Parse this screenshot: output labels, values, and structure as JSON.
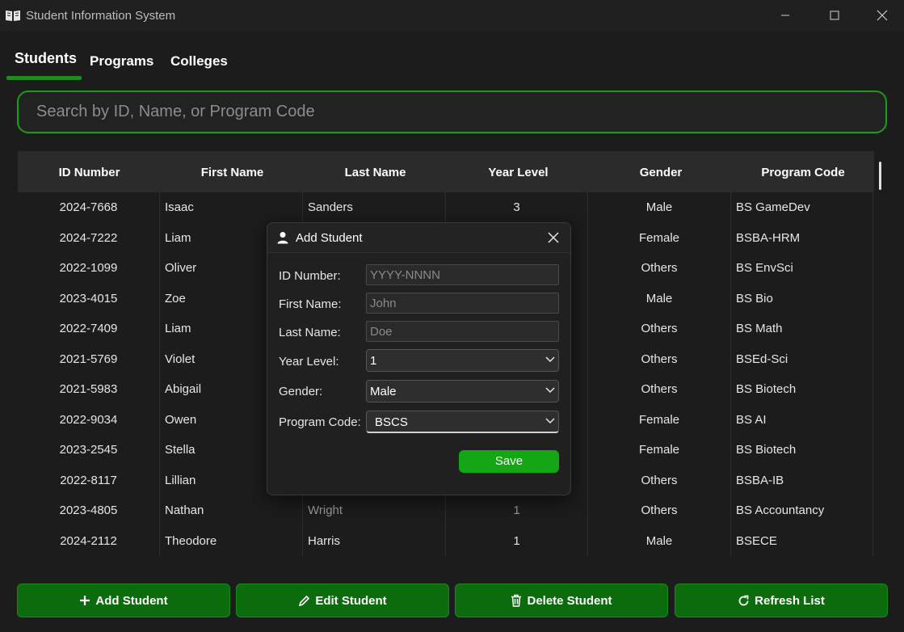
{
  "window": {
    "title": "Student Information System"
  },
  "tabs": [
    "Students",
    "Programs",
    "Colleges"
  ],
  "search": {
    "placeholder": "Search by ID, Name, or Program Code",
    "value": ""
  },
  "table": {
    "columns": [
      "ID Number",
      "First Name",
      "Last Name",
      "Year Level",
      "Gender",
      "Program Code"
    ],
    "rows": [
      [
        "2024-7668",
        "Isaac",
        "Sanders",
        "3",
        "Male",
        "BS GameDev"
      ],
      [
        "2024-7222",
        "Liam",
        "",
        "",
        "Female",
        "BSBA-HRM"
      ],
      [
        "2022-1099",
        "Oliver",
        "",
        "",
        "Others",
        "BS EnvSci"
      ],
      [
        "2023-4015",
        "Zoe",
        "",
        "",
        "Male",
        "BS Bio"
      ],
      [
        "2022-7409",
        "Liam",
        "",
        "",
        "Others",
        "BS Math"
      ],
      [
        "2021-5769",
        "Violet",
        "",
        "",
        "Others",
        "BSEd-Sci"
      ],
      [
        "2021-5983",
        "Abigail",
        "",
        "",
        "Others",
        "BS Biotech"
      ],
      [
        "2022-9034",
        "Owen",
        "",
        "",
        "Female",
        "BS AI"
      ],
      [
        "2023-2545",
        "Stella",
        "",
        "",
        "Female",
        "BS Biotech"
      ],
      [
        "2022-8117",
        "Lillian",
        "",
        "",
        "Others",
        "BSBA-IB"
      ],
      [
        "2023-4805",
        "Nathan",
        "Wright",
        "1",
        "Others",
        "BS Accountancy"
      ],
      [
        "2024-2112",
        "Theodore",
        "Harris",
        "1",
        "Male",
        "BSECE"
      ]
    ]
  },
  "actions": {
    "add": "Add Student",
    "edit": "Edit Student",
    "delete": "Delete Student",
    "refresh": "Refresh List"
  },
  "dialog": {
    "title": "Add Student",
    "fields": {
      "id_label": "ID Number:",
      "id_placeholder": "YYYY-NNNN",
      "first_label": "First Name:",
      "first_placeholder": "John",
      "last_label": "Last Name:",
      "last_placeholder": "Doe",
      "year_label": "Year Level:",
      "year_value": "1",
      "gender_label": "Gender:",
      "gender_value": "Male",
      "program_label": "Program Code:",
      "program_value": "BSCS"
    },
    "save_label": "Save"
  },
  "colors": {
    "accent": "#14a014",
    "button": "#0c6b0c",
    "background": "#1c1c1c"
  },
  "icons": [
    "book-icon",
    "minimize-icon",
    "maximize-icon",
    "close-icon",
    "user-icon",
    "plus-icon",
    "pencil-icon",
    "trash-icon",
    "refresh-icon",
    "chevron-down-icon"
  ]
}
